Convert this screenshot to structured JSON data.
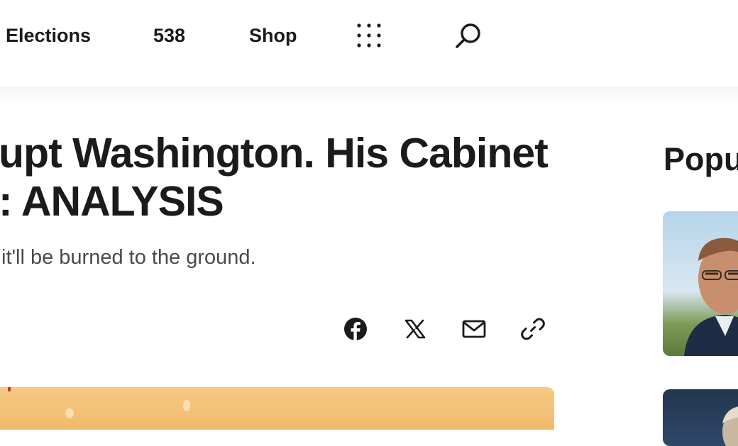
{
  "nav": {
    "items": [
      {
        "label": "Elections"
      },
      {
        "label": "538"
      },
      {
        "label": "Shop"
      }
    ],
    "more_icon": "grid-dots-icon",
    "search_icon": "search-icon"
  },
  "article": {
    "headline_line1": "upt Washington. His Cabinet",
    "headline_line2": ": ANALYSIS",
    "dek": "it'll be burned to the ground."
  },
  "share": {
    "icons": [
      "facebook-icon",
      "x-icon",
      "email-icon",
      "link-icon"
    ]
  },
  "sidebar": {
    "title": "Popu"
  },
  "colors": {
    "text": "#1b1b1b",
    "dek": "#4a4a4a",
    "band": "#f6f6f6",
    "hero": "#f6c983"
  }
}
